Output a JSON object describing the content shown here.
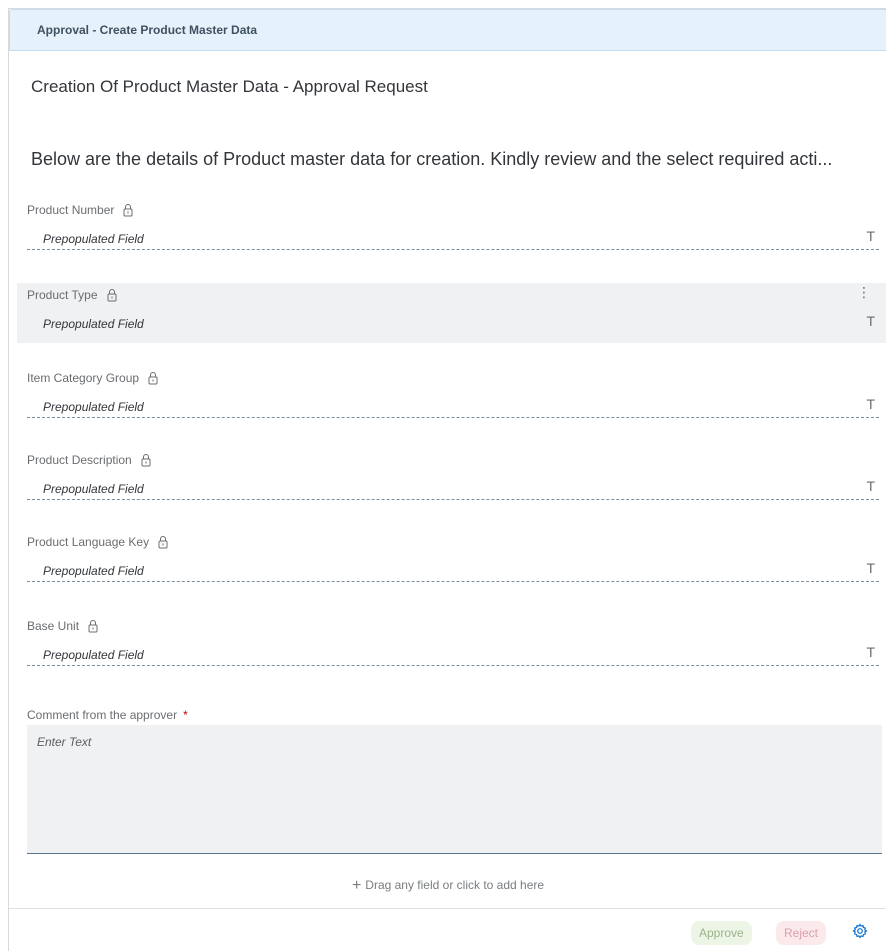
{
  "window": {
    "title": "Approval - Create Product Master Data"
  },
  "form": {
    "heading": "Creation Of Product Master Data - Approval Request",
    "intro": "Below are the details of Product master data for creation. Kindly review and the select required acti..."
  },
  "fields": [
    {
      "label": "Product Number",
      "value": "Prepopulated Field",
      "type_icon": "T"
    },
    {
      "label": "Product Type",
      "value": "Prepopulated Field",
      "type_icon": "T"
    },
    {
      "label": "Item Category Group",
      "value": "Prepopulated Field",
      "type_icon": "T"
    },
    {
      "label": "Product Description",
      "value": "Prepopulated Field",
      "type_icon": "T"
    },
    {
      "label": "Product Language Key",
      "value": "Prepopulated Field",
      "type_icon": "T"
    },
    {
      "label": "Base Unit",
      "value": "Prepopulated Field",
      "type_icon": "T"
    }
  ],
  "comment": {
    "label": "Comment from the approver",
    "required_marker": "*",
    "placeholder": "Enter Text"
  },
  "add_field": {
    "icon": "+",
    "label": "Drag any field or click to add here"
  },
  "actions": {
    "approve_label": "Approve",
    "reject_label": "Reject"
  },
  "icons": {
    "lock": "lock-icon",
    "more": "more-vertical-icon",
    "settings": "gear-icon"
  },
  "colors": {
    "title_bar_bg": "#e5f2fb",
    "approve_bg": "#edf6e6",
    "reject_bg": "#fbe9ec",
    "required": "#bb0000"
  }
}
